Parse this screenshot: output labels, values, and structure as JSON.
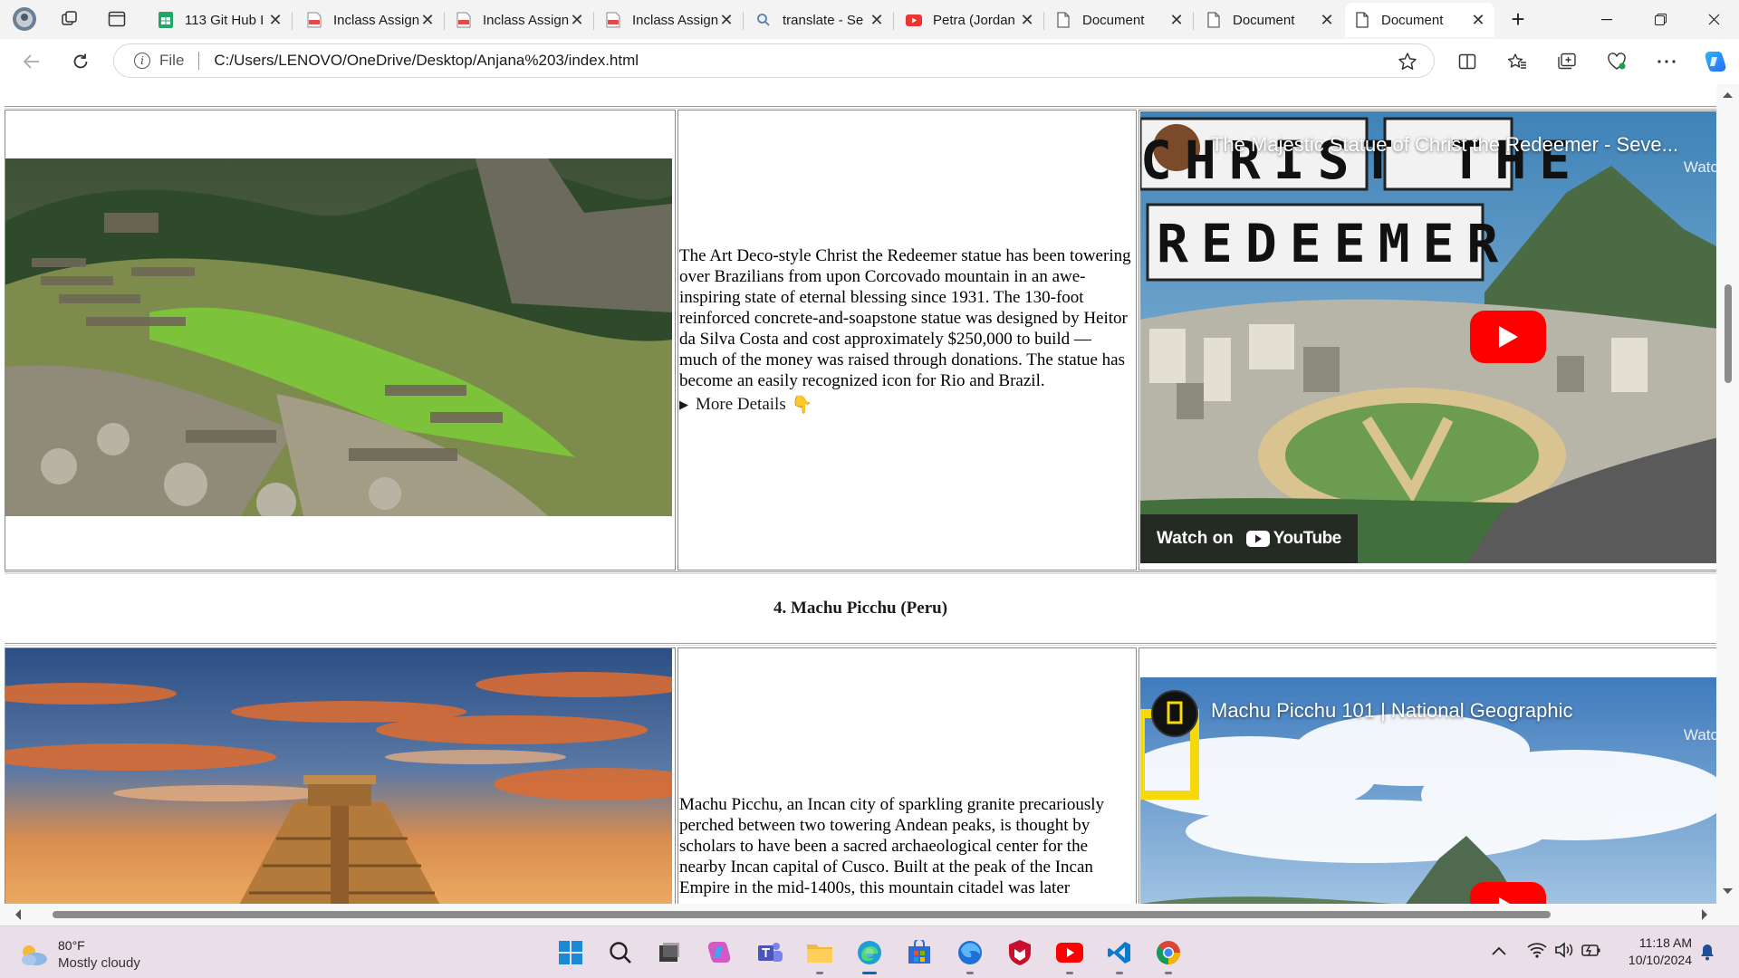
{
  "browser": {
    "tabs": [
      {
        "title": "113 Git Hub I",
        "icon": "sheets-icon",
        "active": false
      },
      {
        "title": "Inclass Assign",
        "icon": "pdf-icon",
        "active": false
      },
      {
        "title": "Inclass Assign",
        "icon": "pdf-icon",
        "active": false
      },
      {
        "title": "Inclass Assign",
        "icon": "pdf-icon",
        "active": false
      },
      {
        "title": "translate - Se",
        "icon": "search-icon",
        "active": false
      },
      {
        "title": "Petra (Jordan",
        "icon": "youtube-icon",
        "active": false
      },
      {
        "title": "Document",
        "icon": "document-icon",
        "active": false
      },
      {
        "title": "Document",
        "icon": "document-icon",
        "active": false
      },
      {
        "title": "Document",
        "icon": "document-icon",
        "active": true
      }
    ],
    "address": {
      "scheme_label": "File",
      "url": "C:/Users/LENOVO/OneDrive/Desktop/Anjana%203/index.html"
    }
  },
  "page": {
    "row1": {
      "description": "The Art Deco-style Christ the Redeemer statue has been towering over Brazilians from upon Corcovado mountain in an awe-inspiring state of eternal blessing since 1931. The 130-foot reinforced concrete-and-soapstone statue was designed by Heitor da Silva Costa and cost approximately $250,000 to build — much of the money was raised through donations. The statue has become an easily recognized icon for Rio and Brazil.",
      "details_label": "More Details",
      "details_emoji": "👇",
      "video": {
        "title": "The Majestic Statue of Christ the Redeemer - Seve...",
        "watch_label": "Watc",
        "overlay_line1": "CHRIST THE",
        "overlay_line2": "REDEEMER",
        "watch_on": "Watch on",
        "youtube": "YouTube"
      }
    },
    "heading": "4. Machu Picchu (Peru)",
    "row2": {
      "description": "Machu Picchu, an Incan city of sparkling granite precariously perched between two towering Andean peaks, is thought by scholars to have been a sacred archaeological center for the nearby Incan capital of Cusco. Built at the peak of the Incan Empire in the mid-1400s, this mountain citadel was later",
      "video": {
        "title": "Machu Picchu 101 | National Geographic",
        "watch_label": "Watc"
      }
    }
  },
  "taskbar": {
    "weather": {
      "temp": "80°F",
      "condition": "Mostly cloudy"
    },
    "clock": {
      "time": "11:18 AM",
      "date": "10/10/2024"
    }
  }
}
